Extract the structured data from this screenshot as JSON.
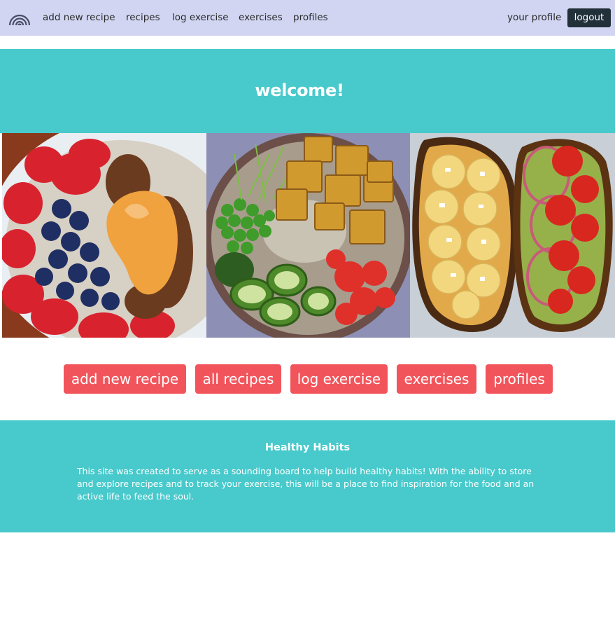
{
  "nav": {
    "logo_icon": "rainbow-icon",
    "links": [
      {
        "label": "add new recipe"
      },
      {
        "label": "recipes"
      },
      {
        "label": "log exercise"
      },
      {
        "label": "exercises"
      },
      {
        "label": "profiles"
      }
    ],
    "profile_label": "your profile",
    "logout_label": "logout"
  },
  "hero": {
    "title": "welcome!"
  },
  "gallery": {
    "images": [
      {
        "subject": "smoothie bowl with strawberries, blueberries, granola and peanut butter"
      },
      {
        "subject": "bowl with tofu cubes, peas, sprouts, zucchini and tomatoes"
      },
      {
        "subject": "toasts with banana slices and avocado with tomato and red onion"
      }
    ]
  },
  "actions": {
    "buttons": [
      {
        "label": "add new recipe"
      },
      {
        "label": "all recipes"
      },
      {
        "label": "log exercise"
      },
      {
        "label": "exercises"
      },
      {
        "label": "profiles"
      }
    ]
  },
  "footer": {
    "title": "Healthy Habits",
    "text": "This site was created to serve as a sounding board to help build healthy habits! With the ability to store and explore recipes and to track your exercise, this will be a place to find inspiration for the food and an active life to feed the soul."
  },
  "colors": {
    "nav_bg": "#d1d5f2",
    "teal": "#48c9cb",
    "button_red": "#f2545b",
    "logout_bg": "#22303a"
  }
}
